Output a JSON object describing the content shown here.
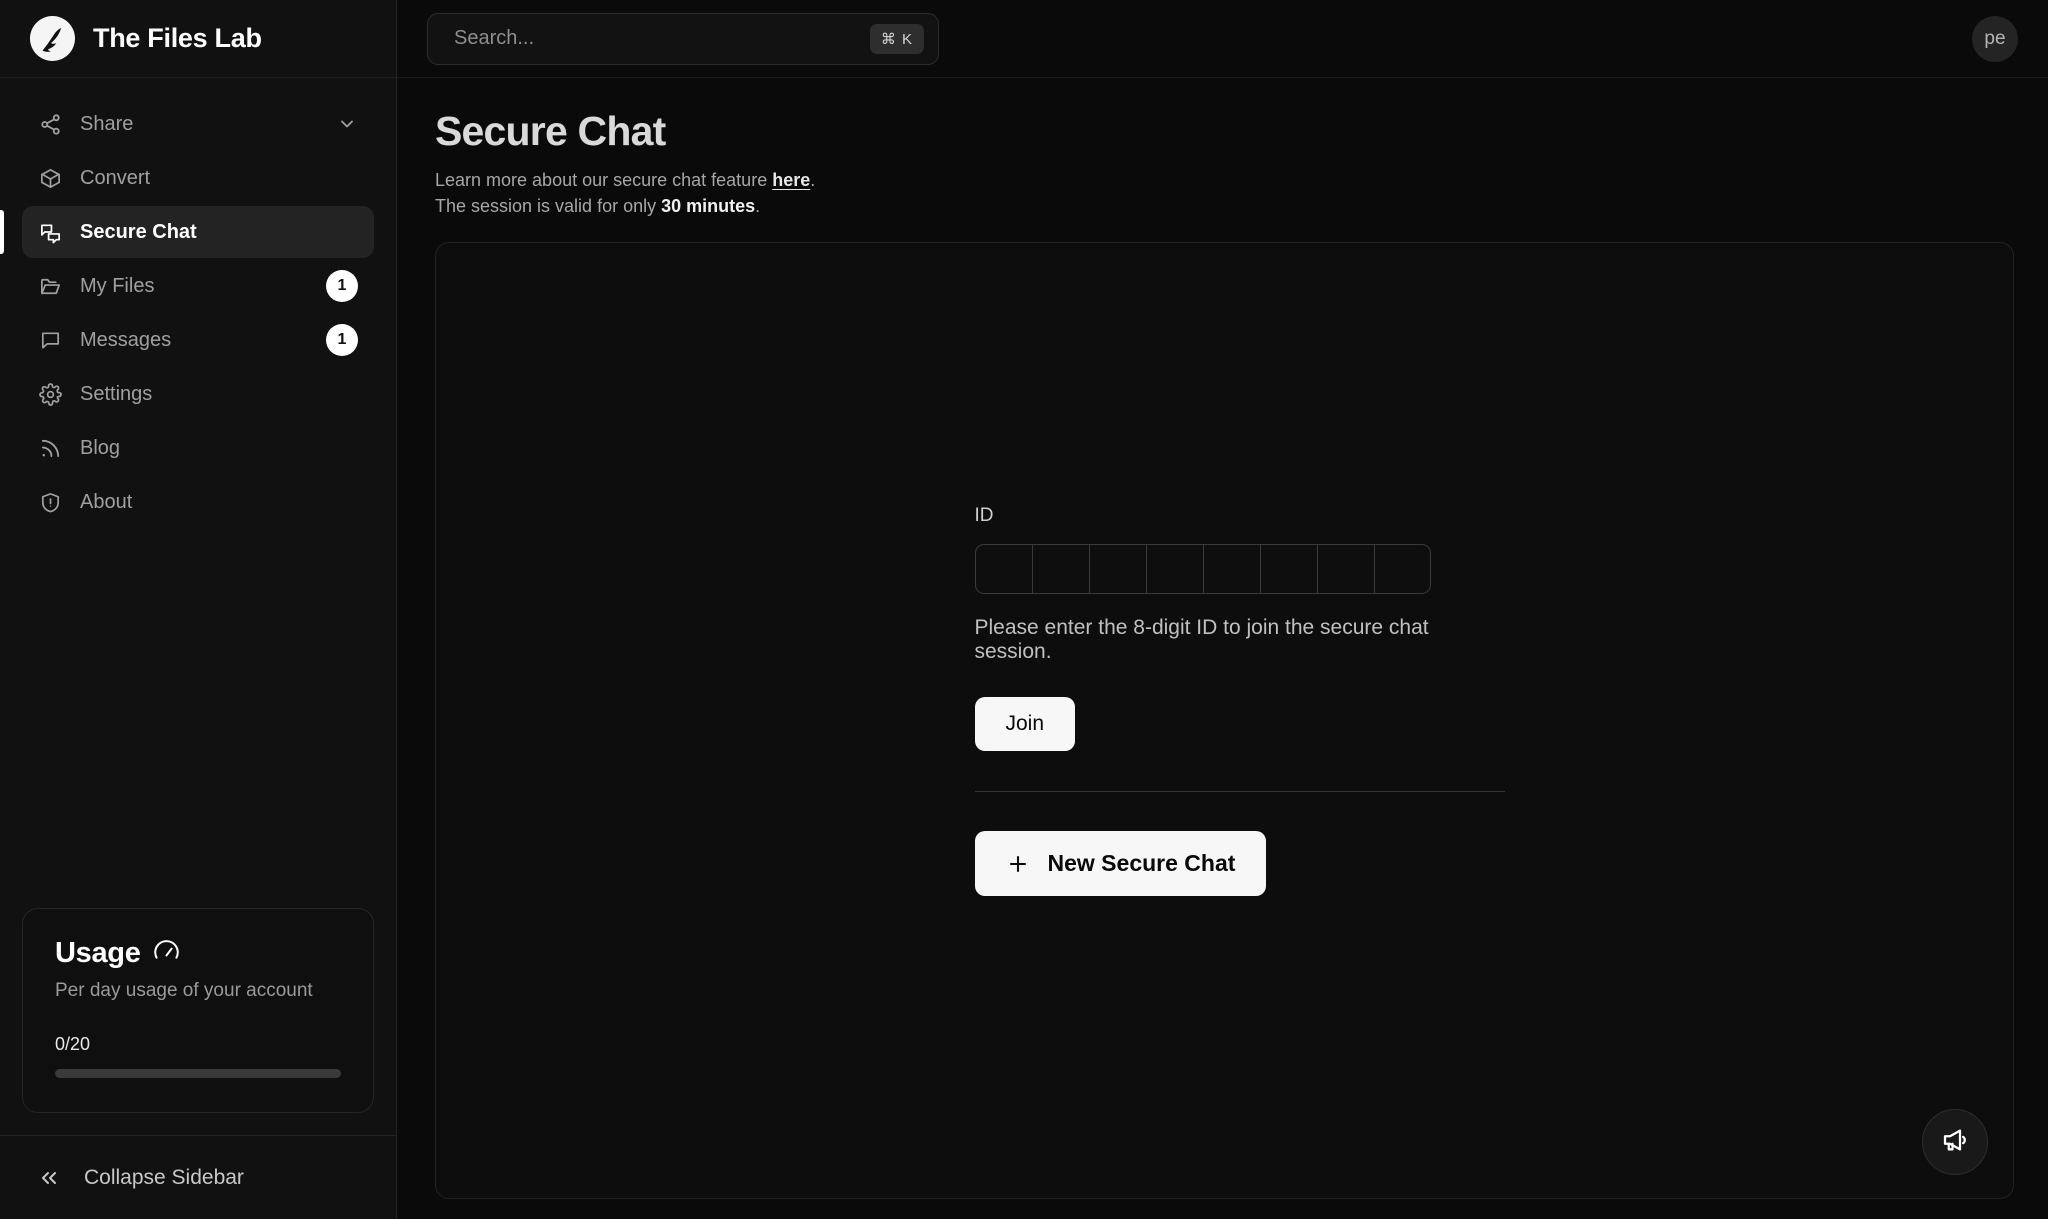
{
  "brand": {
    "name": "The Files Lab",
    "logo_icon": "feather-logo-icon"
  },
  "search": {
    "placeholder": "Search...",
    "shortcut": "⌘ K"
  },
  "user": {
    "avatar_initials": "pe"
  },
  "sidebar": {
    "items": [
      {
        "label": "Share",
        "icon": "share-icon",
        "badge": null,
        "chevron": true,
        "active": false
      },
      {
        "label": "Convert",
        "icon": "box-icon",
        "badge": null,
        "chevron": false,
        "active": false
      },
      {
        "label": "Secure Chat",
        "icon": "chat-bubbles-icon",
        "badge": null,
        "chevron": false,
        "active": true
      },
      {
        "label": "My Files",
        "icon": "folder-icon",
        "badge": "1",
        "chevron": false,
        "active": false
      },
      {
        "label": "Messages",
        "icon": "message-icon",
        "badge": "1",
        "chevron": false,
        "active": false
      },
      {
        "label": "Settings",
        "icon": "gear-icon",
        "badge": null,
        "chevron": false,
        "active": false
      },
      {
        "label": "Blog",
        "icon": "rss-icon",
        "badge": null,
        "chevron": false,
        "active": false
      },
      {
        "label": "About",
        "icon": "shield-alert-icon",
        "badge": null,
        "chevron": false,
        "active": false
      }
    ],
    "usage": {
      "title": "Usage",
      "icon": "gauge-icon",
      "subtitle": "Per day usage of your account",
      "count": "0/20",
      "percent": 0
    },
    "collapse": {
      "label": "Collapse Sidebar",
      "icon": "chevrons-left-icon"
    }
  },
  "page": {
    "title": "Secure Chat",
    "desc_line1_prefix": "Learn more about our secure chat feature ",
    "desc_line1_link": "here",
    "desc_line1_suffix": ".",
    "desc_line2_prefix": "The session is valid for only ",
    "desc_line2_strong": "30 minutes",
    "desc_line2_suffix": "."
  },
  "join_form": {
    "id_label": "ID",
    "otp_length": 8,
    "otp_values": [
      "",
      "",
      "",
      "",
      "",
      "",
      "",
      ""
    ],
    "helper_text": "Please enter the 8-digit ID to join the secure chat session.",
    "join_label": "Join",
    "new_chat_label": "New Secure Chat",
    "new_chat_icon": "plus-icon"
  },
  "fab": {
    "icon": "megaphone-icon"
  },
  "colors": {
    "background": "#0a0a0a",
    "sidebar": "#111111",
    "accent": "#ffffff",
    "active_item": "#232323",
    "muted_text": "#a0a0a0",
    "border": "#242424"
  }
}
